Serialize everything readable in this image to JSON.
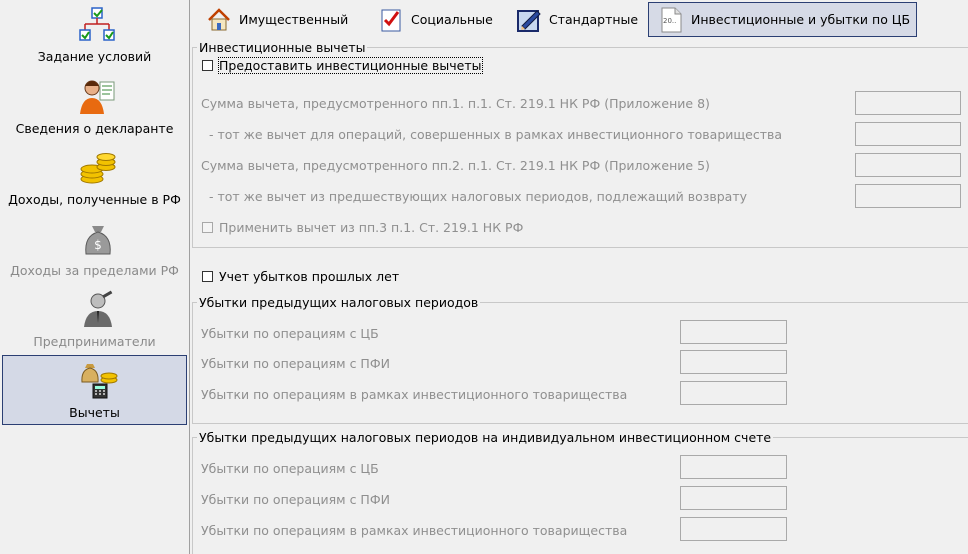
{
  "sidebar": {
    "items": [
      {
        "label": "Задание условий",
        "icon": "conditions-tree-icon"
      },
      {
        "label": "Сведения о декларанте",
        "icon": "person-icon"
      },
      {
        "label": "Доходы, полученные в РФ",
        "icon": "coins-icon"
      },
      {
        "label": "Доходы за пределами РФ",
        "icon": "money-bag-icon"
      },
      {
        "label": "Предприниматели",
        "icon": "businessman-icon"
      },
      {
        "label": "Вычеты",
        "icon": "deductions-icon"
      }
    ]
  },
  "tabs": [
    {
      "label": "Имущественный",
      "icon": "house-icon"
    },
    {
      "label": "Социальные",
      "icon": "checklist-icon"
    },
    {
      "label": "Стандартные",
      "icon": "pencil-form-icon"
    },
    {
      "label": "Инвестиционные и убытки по ЦБ",
      "icon": "document-20-icon",
      "icon_text": "20.."
    }
  ],
  "investment": {
    "title": "Инвестиционные вычеты",
    "provide_checkbox": "Предоставить инвестиционные вычеты",
    "rows": [
      "Сумма вычета, предусмотренного пп.1. п.1. Ст. 219.1 НК РФ (Приложение 8)",
      "- тот же вычет для операций, совершенных в рамках инвестиционного товарищества",
      "Сумма вычета, предусмотренного пп.2. п.1. Ст. 219.1 НК РФ (Приложение 5)",
      "- тот же вычет из предшествующих налоговых периодов, подлежащий возврату"
    ],
    "apply_checkbox": "Применить вычет из пп.3 п.1. Ст. 219.1 НК РФ"
  },
  "losses": {
    "checkbox": "Учет убытков прошлых лет",
    "previous": {
      "title": "Убытки предыдущих налоговых периодов",
      "rows": [
        "Убытки по операциям с ЦБ",
        "Убытки по операциям с ПФИ",
        "Убытки по операциям в рамках инвестиционного товарищества"
      ]
    },
    "iis": {
      "title": "Убытки предыдущих налоговых периодов на индивидуальном инвестиционном счете",
      "rows": [
        "Убытки по операциям с ЦБ",
        "Убытки по операциям с ПФИ",
        "Убытки по операциям в рамках инвестиционного товарищества"
      ]
    }
  }
}
